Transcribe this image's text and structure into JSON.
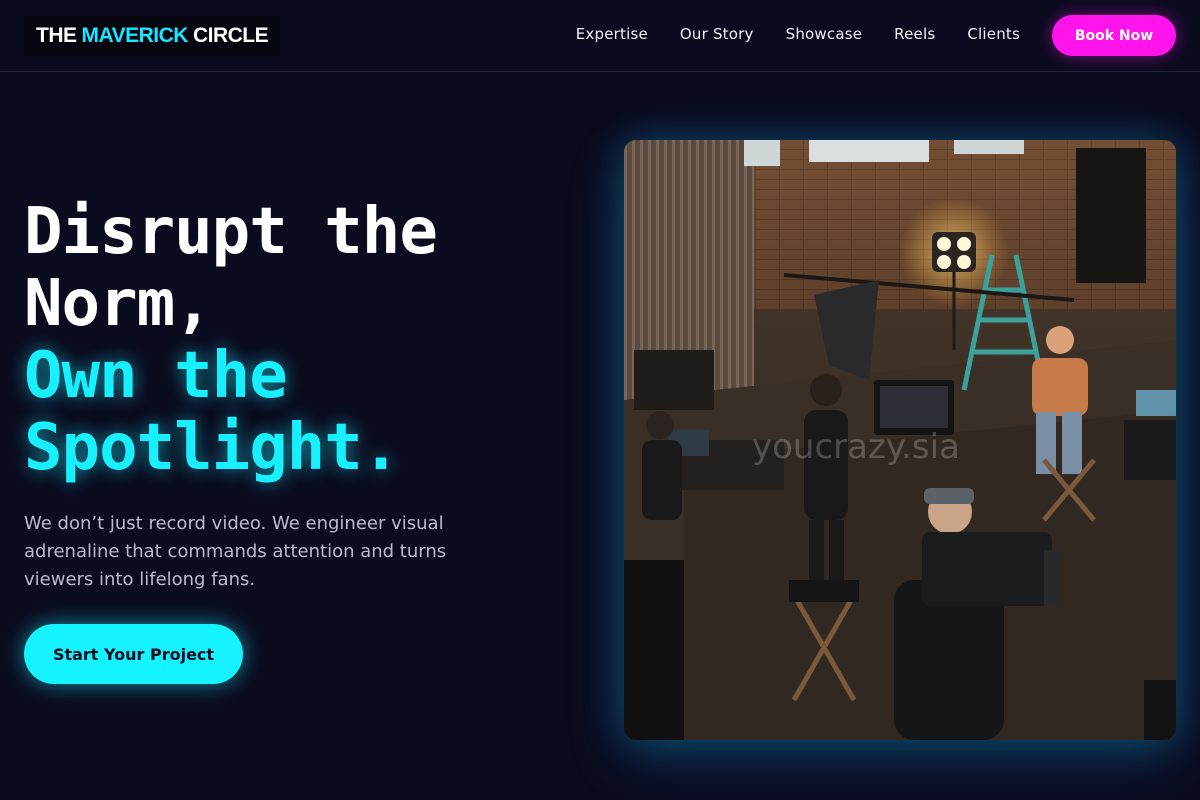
{
  "header": {
    "logo": {
      "part1": "THE",
      "part2": "MAVERICK",
      "part3": "CIRCLE"
    },
    "nav": [
      "Expertise",
      "Our Story",
      "Showcase",
      "Reels",
      "Clients"
    ],
    "cta_label": "Book Now"
  },
  "hero": {
    "title_line1": "Disrupt the",
    "title_line2": "Norm,",
    "title_line3": "Own the",
    "title_line4": "Spotlight.",
    "subtitle": "We don’t just record video. We engineer visual adrenaline that commands attention and turns viewers into lifelong fans.",
    "cta_label": "Start Your Project",
    "image_watermark": "youcrazy.sia"
  },
  "colors": {
    "background": "#0b0b1f",
    "accent_cyan": "#19f0ff",
    "accent_magenta": "#ff14ec"
  }
}
